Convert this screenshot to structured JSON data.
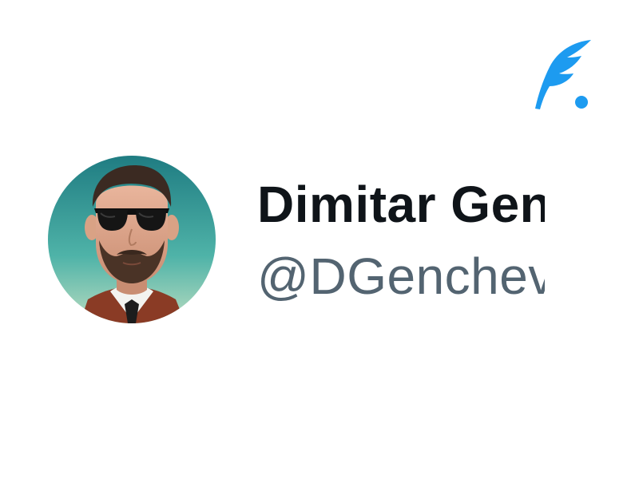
{
  "profile": {
    "display_name": "Dimitar Genchev",
    "handle": "@DGenchev",
    "avatar_icon": "profile-photo"
  },
  "brand": {
    "icon": "feather-quill-logo",
    "accent_color": "#1d9bf0"
  },
  "colors": {
    "name_text": "#0f1419",
    "handle_text": "#536471",
    "background": "#ffffff"
  }
}
